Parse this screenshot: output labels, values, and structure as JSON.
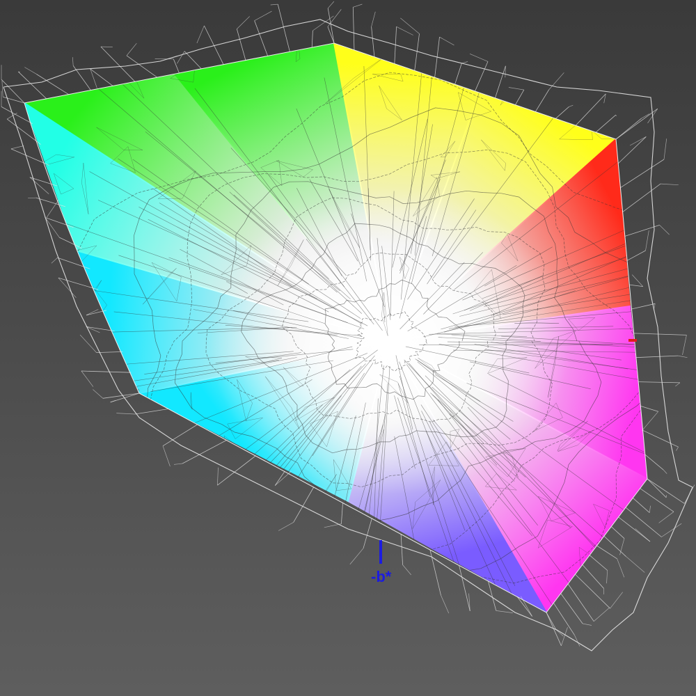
{
  "viewer": {
    "background_color": "#4a4a4a"
  },
  "gamut": {
    "solid_colors": {
      "green": "#2af01a",
      "yellow": "#ffff1a",
      "red": "#ff2a1a",
      "magenta": "#ff36f0",
      "blue": "#7a5cff",
      "cyan": "#12e8ff",
      "cyan_light": "#22ffe6",
      "white": "#ffffff"
    },
    "wireframe_color": "#e6e6e6",
    "mesh_color": "#333333"
  },
  "axes": {
    "neg_b": {
      "label": "-b*",
      "color": "#1c1ce0"
    },
    "a": {
      "label": "",
      "color": "#e01c1c"
    }
  }
}
